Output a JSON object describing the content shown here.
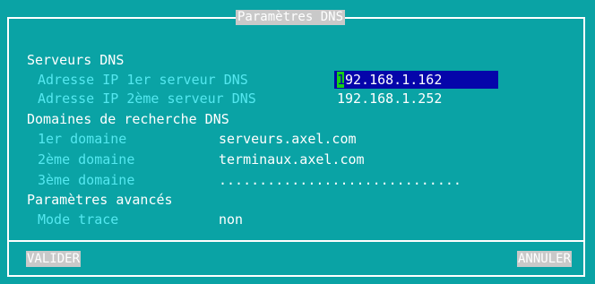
{
  "dialog": {
    "title": "Paramètres DNS"
  },
  "sections": {
    "servers": {
      "heading": "Serveurs DNS",
      "ip1_label": "Adresse IP 1er serveur DNS",
      "ip1_cursor_char": "1",
      "ip1_value_rest": "92.168.1.162",
      "ip2_label": "Adresse IP 2ème serveur DNS",
      "ip2_value": "192.168.1.252"
    },
    "domains": {
      "heading": "Domaines de recherche DNS",
      "d1_label": "1er domaine",
      "d1_value": "serveurs.axel.com",
      "d2_label": "2ème domaine",
      "d2_value": "terminaux.axel.com",
      "d3_label": "3ème domaine",
      "d3_value": ".............................."
    },
    "advanced": {
      "heading": "Paramètres avancés",
      "trace_label": "Mode trace",
      "trace_value": "non"
    }
  },
  "buttons": {
    "validate": "VALIDER",
    "cancel": "ANNULER"
  },
  "colors": {
    "background": "#0aa3a5",
    "label": "#54e8f0",
    "active_field": "#0505aa",
    "cursor": "#16d116",
    "button": "#c9c9c9"
  }
}
